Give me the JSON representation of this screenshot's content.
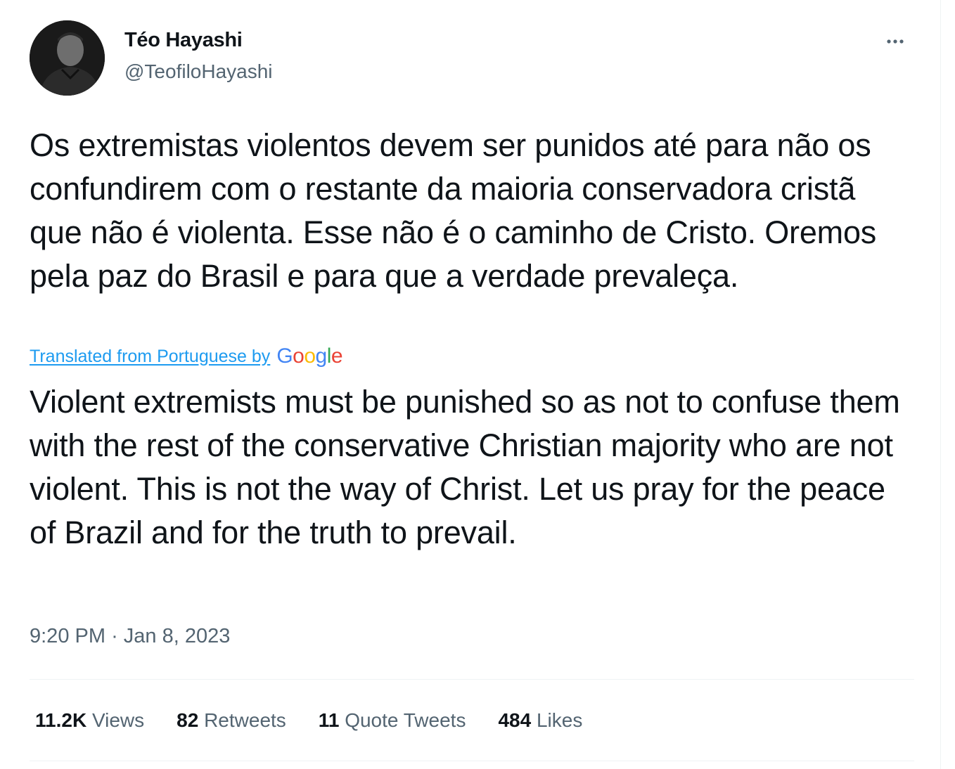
{
  "author": {
    "name": "Téo Hayashi",
    "handle": "@TeofiloHayashi"
  },
  "tweet": {
    "original_text": "Os extremistas violentos devem ser punidos até para não os confundirem com o restante da maioria conservadora cristã que não é violenta. Esse não é o caminho de Cristo. Oremos pela paz do Brasil e para que a verdade prevaleça.",
    "translation_label": "Translated from Portuguese by",
    "translation_provider": "Google",
    "translated_text": "Violent extremists must be punished so as not to confuse them with the rest of the conservative Christian majority who are not violent. This is not the way of Christ. Let us pray for the peace of Brazil and for the truth to prevail.",
    "time": "9:20 PM",
    "separator": "·",
    "date": "Jan 8, 2023"
  },
  "stats": {
    "views": {
      "count": "11.2K",
      "label": "Views"
    },
    "retweets": {
      "count": "82",
      "label": "Retweets"
    },
    "quote_tweets": {
      "count": "11",
      "label": "Quote Tweets"
    },
    "likes": {
      "count": "484",
      "label": "Likes"
    }
  },
  "icons": {
    "more": "more-horizontal-icon",
    "avatar": "profile-photo"
  },
  "colors": {
    "text_primary": "#0f1419",
    "text_secondary": "#536471",
    "link": "#1d9bf0",
    "divider": "#eff3f4",
    "google_blue": "#4285f4",
    "google_red": "#ea4335",
    "google_yellow": "#fbbc05",
    "google_green": "#34a853"
  }
}
